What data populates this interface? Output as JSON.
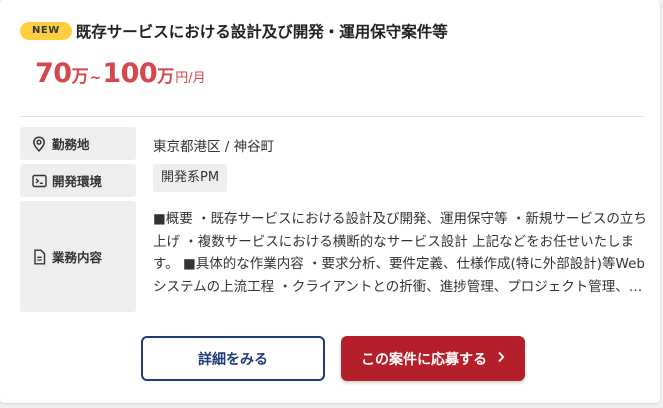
{
  "badge": {
    "label": "NEW",
    "color": "#ffcf3f"
  },
  "job": {
    "title": "既存サービスにおける設計及び開発・運用保守案件等"
  },
  "salary": {
    "min": "70",
    "min_unit": "万",
    "separator": "~",
    "max": "100",
    "max_unit": "万",
    "period": "円/月",
    "color": "#d6464a"
  },
  "info": {
    "location": {
      "label": "勤務地",
      "icon": "location-pin-icon",
      "value": "東京都港区 / 神谷町"
    },
    "environment": {
      "label": "開発環境",
      "icon": "terminal-icon",
      "tag": "開発系PM"
    },
    "description": {
      "label": "業務内容",
      "icon": "document-icon",
      "text": "■概要 ・既存サービスにおける設計及び開発、運用保守等 ・新規サービスの立ち上げ ・複数サービスにおける横断的なサービス設計 上記などをお任せいたします。 ■具体的な作業内容 ・要求分析、要件定義、仕様作成(特に外部設計)等Webシステムの上流工程 ・クライアントとの折衝、進捗管理、プロジェクト管理、予算管理 ・要望をヒアリングした上での開発計…"
    }
  },
  "buttons": {
    "detail_label": "詳細をみる",
    "apply_label": "この案件に応募する",
    "apply_icon": "chevron-right-icon",
    "detail_color": "#1d3c78",
    "apply_color": "#b51f2a"
  }
}
